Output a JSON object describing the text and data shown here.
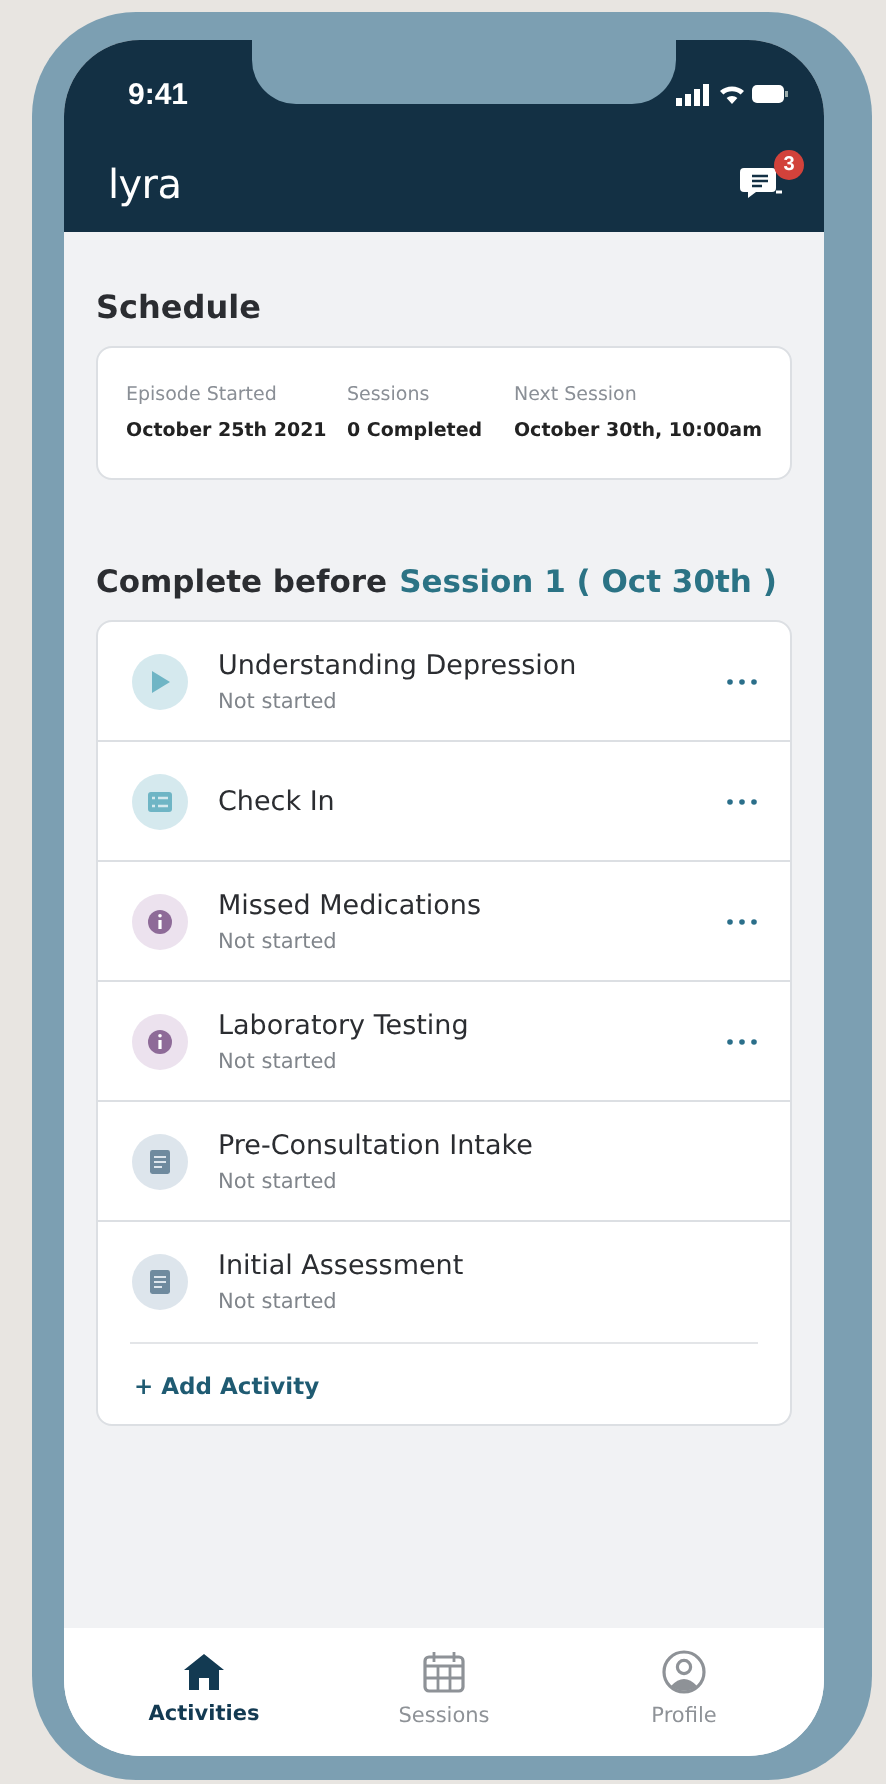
{
  "status_bar": {
    "time": "9:41"
  },
  "app_bar": {
    "logo": "lyra",
    "messages_badge": "3"
  },
  "schedule": {
    "title": "Schedule",
    "fields": [
      {
        "label": "Episode Started",
        "value": "October 25th 2021"
      },
      {
        "label": "Sessions",
        "value": "0 Completed"
      },
      {
        "label": "Next Session",
        "value": "October 30th, 10:00am"
      }
    ]
  },
  "activities": {
    "heading": "Complete before",
    "session": "Session 1 ( Oct 30th )",
    "items": [
      {
        "kind": "video",
        "title": "Understanding Depression",
        "status": "Not started",
        "has_menu": true
      },
      {
        "kind": "checklist",
        "title": "Check In",
        "has_menu": true
      },
      {
        "kind": "info",
        "title": "Missed Medications",
        "status": "Not started",
        "has_menu": true
      },
      {
        "kind": "info",
        "title": "Laboratory Testing",
        "status": "Not started",
        "has_menu": true
      },
      {
        "kind": "form",
        "title": "Pre-Consultation Intake",
        "status": "Not started",
        "has_menu": false
      },
      {
        "kind": "form",
        "title": "Initial Assessment",
        "status": "Not started",
        "has_menu": false
      }
    ],
    "add_label": "+ Add Activity"
  },
  "tabs": [
    {
      "kind": "home",
      "label": "Activities",
      "selected": true
    },
    {
      "kind": "calendar",
      "label": "Sessions",
      "selected": false
    },
    {
      "kind": "profile",
      "label": "Profile",
      "selected": false
    }
  ]
}
